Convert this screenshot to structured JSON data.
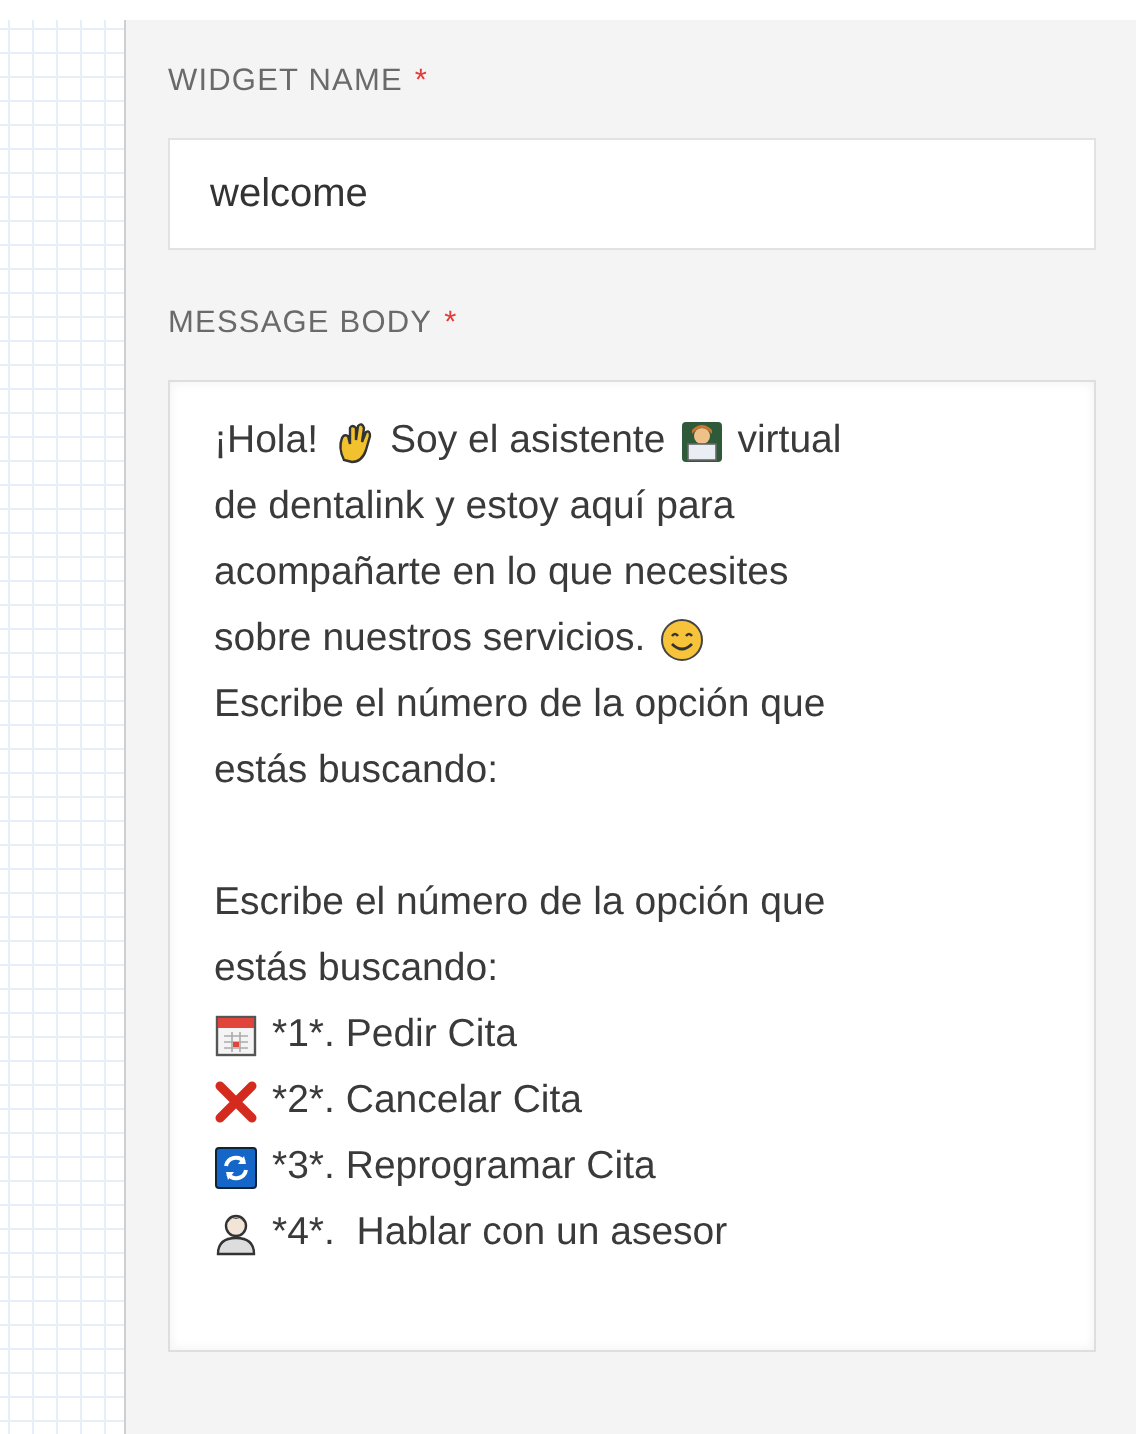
{
  "widget_name": {
    "label": "WIDGET NAME",
    "required_mark": "*",
    "value": "welcome"
  },
  "message_body": {
    "label": "MESSAGE BODY",
    "required_mark": "*",
    "paragraphs": [
      [
        [
          {
            "kind": "text",
            "text": "¡Hola!"
          },
          {
            "kind": "hand"
          },
          {
            "kind": "text",
            "text": "Soy el asistente"
          },
          {
            "kind": "laptop"
          },
          {
            "kind": "text",
            "text": "virtual"
          }
        ],
        [
          {
            "kind": "text",
            "text": "de dentalink y estoy aquí para"
          }
        ],
        [
          {
            "kind": "text",
            "text": "acompañarte en lo que necesites"
          }
        ],
        [
          {
            "kind": "text",
            "text": "sobre nuestros servicios."
          },
          {
            "kind": "smile"
          }
        ],
        [
          {
            "kind": "text",
            "text": "Escribe el número de la opción que"
          }
        ],
        [
          {
            "kind": "text",
            "text": "estás buscando:"
          }
        ]
      ],
      [
        [
          {
            "kind": "text",
            "text": "Escribe el número de la opción que"
          }
        ],
        [
          {
            "kind": "text",
            "text": "estás buscando:"
          }
        ],
        [
          {
            "kind": "calendar"
          },
          {
            "kind": "text",
            "text": "*1*. Pedir Cita"
          }
        ],
        [
          {
            "kind": "cross"
          },
          {
            "kind": "text",
            "text": "*2*. Cancelar Cita"
          }
        ],
        [
          {
            "kind": "refresh"
          },
          {
            "kind": "text",
            "text": "*3*. Reprogramar Cita"
          }
        ],
        [
          {
            "kind": "person"
          },
          {
            "kind": "text",
            "text": "*4*.  Hablar con un asesor"
          }
        ]
      ]
    ]
  }
}
